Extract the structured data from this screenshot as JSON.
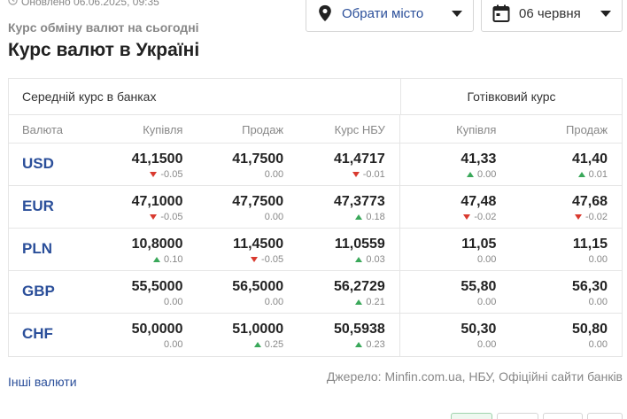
{
  "header": {
    "updated": "Оновлено 06.06.2025, 09:35",
    "subtitle": "Курс обміну валют на сьогодні",
    "title": "Курс валют в Україні"
  },
  "controls": {
    "city_label": "Обрати місто",
    "date_label": "06 червня"
  },
  "table": {
    "group_bank": "Середній курс в банках",
    "group_cash": "Готівковий курс",
    "columns": [
      "Валюта",
      "Купівля",
      "Продаж",
      "Курс НБУ",
      "Купівля",
      "Продаж"
    ],
    "rows": [
      {
        "code": "USD",
        "buy": "41,1500",
        "buy_chg": "-0.05",
        "buy_dir": "down",
        "sell": "41,7500",
        "sell_chg": "0.00",
        "sell_dir": "none",
        "nbu": "41,4717",
        "nbu_chg": "-0.01",
        "nbu_dir": "down",
        "cbuy": "41,33",
        "cbuy_chg": "0.00",
        "cbuy_dir": "up",
        "csell": "41,40",
        "csell_chg": "0.01",
        "csell_dir": "up"
      },
      {
        "code": "EUR",
        "buy": "47,1000",
        "buy_chg": "-0.05",
        "buy_dir": "down",
        "sell": "47,7500",
        "sell_chg": "0.00",
        "sell_dir": "none",
        "nbu": "47,3773",
        "nbu_chg": "0.18",
        "nbu_dir": "up",
        "cbuy": "47,48",
        "cbuy_chg": "-0.02",
        "cbuy_dir": "down",
        "csell": "47,68",
        "csell_chg": "-0.02",
        "csell_dir": "down"
      },
      {
        "code": "PLN",
        "buy": "10,8000",
        "buy_chg": "0.10",
        "buy_dir": "up",
        "sell": "11,4500",
        "sell_chg": "-0.05",
        "sell_dir": "down",
        "nbu": "11,0559",
        "nbu_chg": "0.03",
        "nbu_dir": "up",
        "cbuy": "11,05",
        "cbuy_chg": "0.00",
        "cbuy_dir": "none",
        "csell": "11,15",
        "csell_chg": "0.00",
        "csell_dir": "none"
      },
      {
        "code": "GBP",
        "buy": "55,5000",
        "buy_chg": "0.00",
        "buy_dir": "none",
        "sell": "56,5000",
        "sell_chg": "0.00",
        "sell_dir": "none",
        "nbu": "56,2729",
        "nbu_chg": "0.21",
        "nbu_dir": "up",
        "cbuy": "55,80",
        "cbuy_chg": "0.00",
        "cbuy_dir": "none",
        "csell": "56,30",
        "csell_chg": "0.00",
        "csell_dir": "none"
      },
      {
        "code": "CHF",
        "buy": "50,0000",
        "buy_chg": "0.00",
        "buy_dir": "none",
        "sell": "51,0000",
        "sell_chg": "0.25",
        "sell_dir": "up",
        "nbu": "50,5938",
        "nbu_chg": "0.23",
        "nbu_dir": "up",
        "cbuy": "50,30",
        "cbuy_chg": "0.00",
        "cbuy_dir": "none",
        "csell": "50,80",
        "csell_chg": "0.00",
        "csell_dir": "none"
      }
    ]
  },
  "footer": {
    "other_link": "Інші валюти",
    "source": "Джерело: Minfin.com.ua, НБУ, Офіційні сайти банків"
  },
  "colors": {
    "link": "#2b4f9a",
    "up": "#3aa85a",
    "down": "#d93a2f",
    "muted": "#888888"
  },
  "icons": {
    "updated": "clock-icon",
    "city": "map-pin-icon",
    "date": "calendar-icon",
    "dropdown": "caret-down-icon"
  }
}
